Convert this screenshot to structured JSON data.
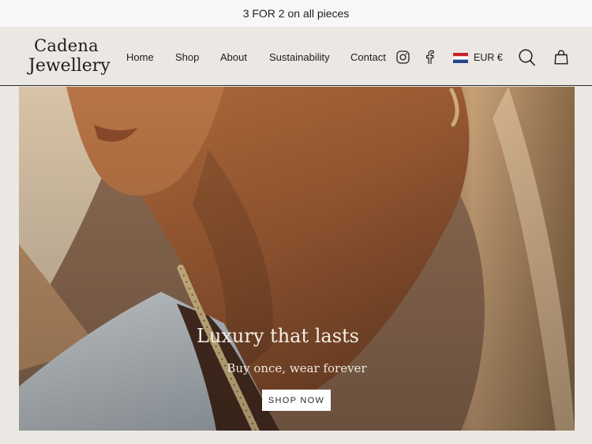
{
  "announcement": "3 FOR 2 on all pieces",
  "logo": {
    "line1": "Cadena",
    "line2": "Jewellery"
  },
  "nav": [
    {
      "label": "Home"
    },
    {
      "label": "Shop"
    },
    {
      "label": "About"
    },
    {
      "label": "Sustainability"
    },
    {
      "label": "Contact"
    }
  ],
  "icons": {
    "instagram": "instagram-icon",
    "facebook": "facebook-icon",
    "flag": "netherlands-flag-icon",
    "search": "search-icon",
    "cart": "cart-bag-icon"
  },
  "currency": {
    "label": "EUR €"
  },
  "hero": {
    "title": "Luxury that lasts",
    "subtitle": "Buy once, wear forever",
    "button": "SHOP NOW"
  },
  "colors": {
    "background": "#ebe8e3",
    "announcement_bg": "#f7f7f7",
    "text": "#1d1d1d",
    "hero_text": "#f4efe6"
  }
}
